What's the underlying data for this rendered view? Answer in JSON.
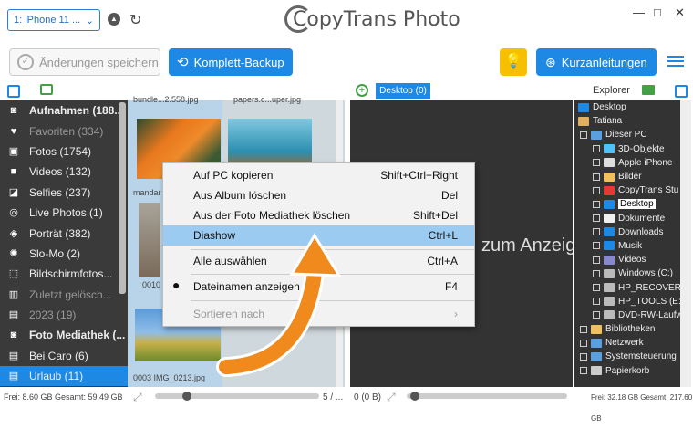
{
  "header": {
    "device": "1: iPhone 11 ...",
    "app_title": "CopyTrans Photo",
    "window_controls": [
      "—",
      "□",
      "✕"
    ]
  },
  "toolbar": {
    "save_label": "Änderungen speichern",
    "backup_label": "Komplett-Backup",
    "guides_label": "Kurzanleitungen"
  },
  "sidebar": {
    "items": [
      {
        "label": "Aufnahmen (188...",
        "icon": "camera-icon",
        "style": "bold"
      },
      {
        "label": "Favoriten (334)",
        "icon": "heart-icon",
        "style": "dim"
      },
      {
        "label": "Fotos (1754)",
        "icon": "image-icon",
        "style": ""
      },
      {
        "label": "Videos (132)",
        "icon": "video-icon",
        "style": ""
      },
      {
        "label": "Selfies (237)",
        "icon": "selfie-icon",
        "style": ""
      },
      {
        "label": "Live Photos (1)",
        "icon": "live-icon",
        "style": ""
      },
      {
        "label": "Porträt (382)",
        "icon": "cube-icon",
        "style": ""
      },
      {
        "label": "Slo-Mo (2)",
        "icon": "slomo-icon",
        "style": ""
      },
      {
        "label": "Bildschirmfotos...",
        "icon": "screenshot-icon",
        "style": ""
      },
      {
        "label": "Zuletzt gelösch...",
        "icon": "trash-icon",
        "style": "dim"
      },
      {
        "label": "2023 (19)",
        "icon": "album-icon",
        "style": "dim"
      },
      {
        "label": "Foto Mediathek (...",
        "icon": "camera-icon",
        "style": "bold"
      },
      {
        "label": "Bei Caro (6)",
        "icon": "album-icon",
        "style": ""
      },
      {
        "label": "Urlaub (11)",
        "icon": "album-icon",
        "style": "sel"
      }
    ]
  },
  "grid": {
    "top_captions": [
      "bundle...2.558.jpg",
      "papers.c...uper.jpg"
    ],
    "caption_left1": "mandar",
    "caption_0010": "0010",
    "caption_bottom": "0003 IMG_0213.jpg",
    "page": "5 / ..."
  },
  "desktop": {
    "tab_label": "Desktop (0)",
    "center_text": "zum Anzeige",
    "status": "0 (0 B)"
  },
  "explorer": {
    "title": "Explorer",
    "tree": [
      {
        "label": "Desktop",
        "color": "#1e88e5",
        "exp": false
      },
      {
        "label": "Tatiana",
        "color": "#e0b060",
        "exp": false
      },
      {
        "label": "Dieser PC",
        "color": "#5aa0e0",
        "exp": true
      },
      {
        "label": "3D-Objekte",
        "color": "#4fc3f7",
        "exp": true
      },
      {
        "label": "Apple iPhone",
        "color": "#dddddd",
        "exp": true
      },
      {
        "label": "Bilder",
        "color": "#f0c060",
        "exp": true
      },
      {
        "label": "CopyTrans Stu",
        "color": "#e53935",
        "exp": true
      },
      {
        "label": "Desktop",
        "color": "#1e88e5",
        "exp": true,
        "sel": true
      },
      {
        "label": "Dokumente",
        "color": "#f0f0f0",
        "exp": true
      },
      {
        "label": "Downloads",
        "color": "#1e88e5",
        "exp": true
      },
      {
        "label": "Musik",
        "color": "#1e88e5",
        "exp": true
      },
      {
        "label": "Videos",
        "color": "#8888cc",
        "exp": true
      },
      {
        "label": "Windows (C:)",
        "color": "#bbbbbb",
        "exp": true
      },
      {
        "label": "HP_RECOVERY",
        "color": "#bbbbbb",
        "exp": true
      },
      {
        "label": "HP_TOOLS (E:",
        "color": "#bbbbbb",
        "exp": true
      },
      {
        "label": "DVD-RW-Laufw",
        "color": "#bbbbbb",
        "exp": true
      },
      {
        "label": "Bibliotheken",
        "color": "#f0c060",
        "exp": true
      },
      {
        "label": "Netzwerk",
        "color": "#5aa0e0",
        "exp": true
      },
      {
        "label": "Systemsteuerung",
        "color": "#5aa0e0",
        "exp": true
      },
      {
        "label": "Papierkorb",
        "color": "#cccccc",
        "exp": true
      }
    ]
  },
  "status": {
    "left": "Frei: 8.60 GB Gesamt: 59.49 GB",
    "right": "Frei: 32.18 GB Gesamt: 217.60 GB"
  },
  "context_menu": {
    "items": [
      {
        "label": "Auf PC kopieren",
        "shortcut": "Shift+Ctrl+Right"
      },
      {
        "label": "Aus Album löschen",
        "shortcut": "Del"
      },
      {
        "label": "Aus der Foto Mediathek löschen",
        "shortcut": "Shift+Del"
      },
      {
        "label": "Diashow",
        "shortcut": "Ctrl+L"
      },
      {
        "label": "Alle auswählen",
        "shortcut": "Ctrl+A"
      },
      {
        "label": "Dateinamen anzeigen",
        "shortcut": "F4"
      },
      {
        "label": "Sortieren nach",
        "shortcut": "›"
      }
    ]
  },
  "colors": {
    "accent": "#1e88e5",
    "highlight": "#9ccbf2",
    "arrow": "#f08a1c"
  }
}
